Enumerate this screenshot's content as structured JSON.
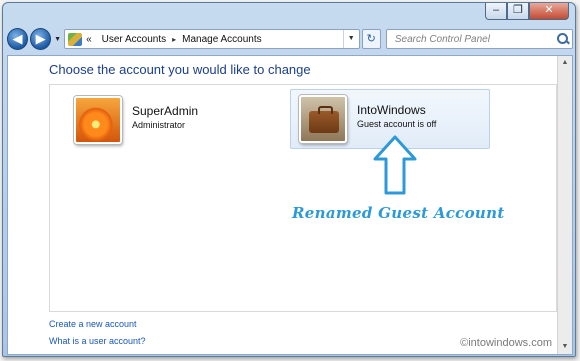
{
  "window": {
    "caption_buttons": [
      "–",
      "❐",
      "✕"
    ]
  },
  "navbar": {
    "back_glyph": "◀",
    "forward_glyph": "▶",
    "overflow_glyph": "«",
    "breadcrumbs": [
      "User Accounts",
      "Manage Accounts"
    ],
    "crumb_separator": "▸",
    "refresh_glyph": "↻",
    "search_placeholder": "Search Control Panel"
  },
  "main": {
    "heading": "Choose the account you would like to change",
    "accounts": [
      {
        "name": "SuperAdmin",
        "type": "Administrator",
        "picture": "orange-flower"
      },
      {
        "name": "IntoWindows",
        "type": "Guest account is off",
        "picture": "briefcase"
      }
    ],
    "links": [
      "Create a new account",
      "What is a user account?"
    ]
  },
  "annotation": {
    "text": "Renamed Guest Account",
    "color": "#2d99d8"
  },
  "watermark": "©intowindows.com",
  "colors": {
    "heading": "#1b3f8c",
    "link": "#1a57b8",
    "close_button": "#c24a32",
    "selection_border": "#b9d1ea"
  }
}
